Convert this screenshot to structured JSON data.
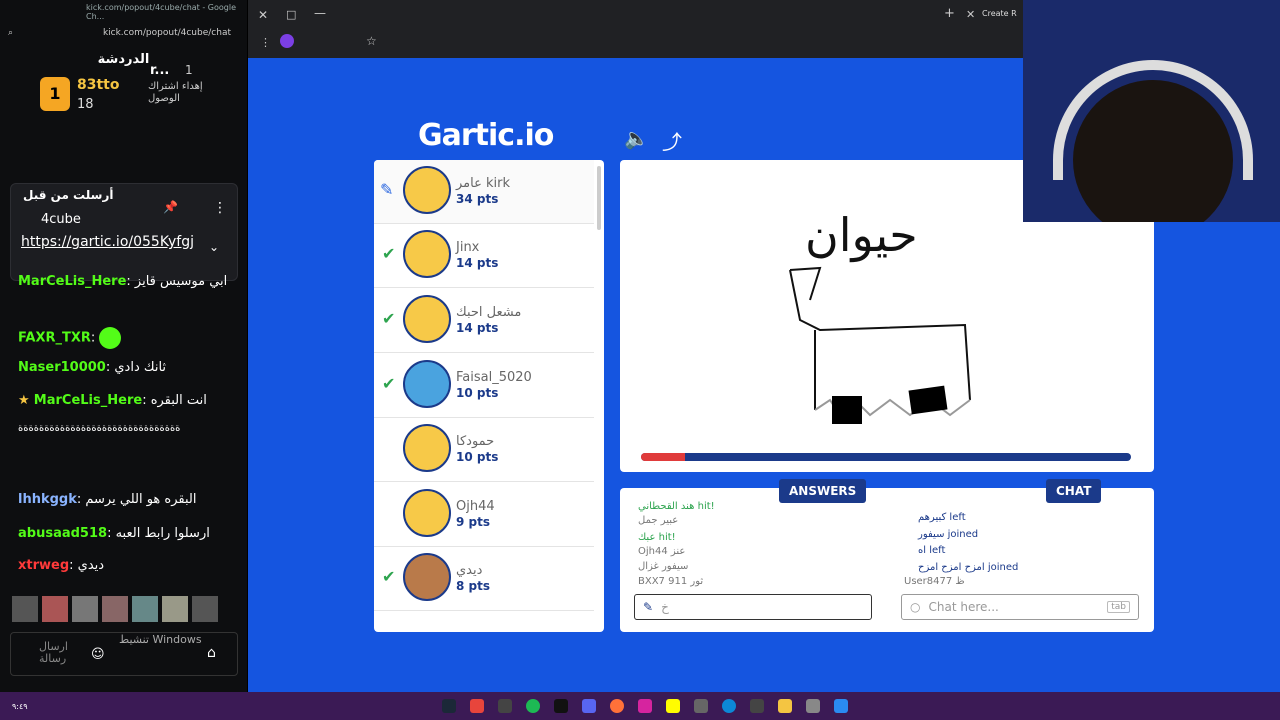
{
  "left_browser": {
    "tab_title": "kick.com/popout/4cube/chat - Google Ch...",
    "url": "kick.com/popout/4cube/chat"
  },
  "chat": {
    "title": "الدردشة",
    "leaderboard": {
      "first_name": "83tto",
      "first_count": "18",
      "second_name": "r...",
      "second_count": "1",
      "third_text": "إهداء اشتراك الوصول"
    },
    "pinned": {
      "header": "أرسلت من قبل",
      "user": "4cube",
      "link": "https://gartic.io/055Kyfgj"
    },
    "messages": [
      {
        "user": "MarCeLis_Here",
        "text": "ابي موسيس قايز"
      },
      {
        "user": "FAXR_TXR",
        "text": ""
      },
      {
        "user": "Naser10000",
        "text": "ثانك دادي"
      },
      {
        "user": "MarCeLis_Here",
        "text": "انت البقره"
      },
      {
        "user": "",
        "text": "ةةةةةةةةةةةةةةةةةةةةةةةةةةةةةةة"
      },
      {
        "user": "lhhkggk",
        "text": "البقره هو اللي يرسم"
      },
      {
        "user": "abusaad518",
        "text": "ارسلوا رابط العبه"
      },
      {
        "user": "xtrweg",
        "text": "ديدي"
      }
    ],
    "send_label": "ارسال رسالة",
    "watermark": "تنشيط Windows"
  },
  "game": {
    "logo": "Gartic.io",
    "drawing_word": "حيوان",
    "progress": 0.09,
    "players": [
      {
        "name": "عامر kirk",
        "pts": "34 pts",
        "status": "drawing"
      },
      {
        "name": "Jinx",
        "pts": "14 pts",
        "status": "hit"
      },
      {
        "name": "مشعل احبك",
        "pts": "14 pts",
        "status": "hit"
      },
      {
        "name": "Faisal_5020",
        "pts": "10 pts",
        "status": "hit"
      },
      {
        "name": "حمودكا",
        "pts": "10 pts",
        "status": ""
      },
      {
        "name": "Ojh44",
        "pts": "9 pts",
        "status": ""
      },
      {
        "name": "ديدي",
        "pts": "8 pts",
        "status": "hit"
      }
    ],
    "answers_tab": "ANSWERS",
    "chat_tab": "CHAT",
    "answers": [
      {
        "text": "هند القحطاني hit!"
      },
      {
        "text": "عبير جمل"
      },
      {
        "text": "عبك hit!"
      },
      {
        "text": "Ojh44 عنز"
      },
      {
        "text": "سيفور غزال"
      },
      {
        "text": "BXX7 911 ثور"
      }
    ],
    "chat_lines": [
      {
        "text": "كبيرهم left"
      },
      {
        "text": "سيفور joined"
      },
      {
        "text": "اه left"
      },
      {
        "text": "امزح امزح امزح joined"
      },
      {
        "text": "User8477 ظ"
      }
    ],
    "answer_input": "خ",
    "chat_placeholder": "Chat here...",
    "tab_key": "tab"
  },
  "browser_right": {
    "tab_title": "Create R"
  },
  "colors": {
    "brand_blue": "#1555e0",
    "navy": "#1b3a8a",
    "kick_green": "#53fc18"
  }
}
